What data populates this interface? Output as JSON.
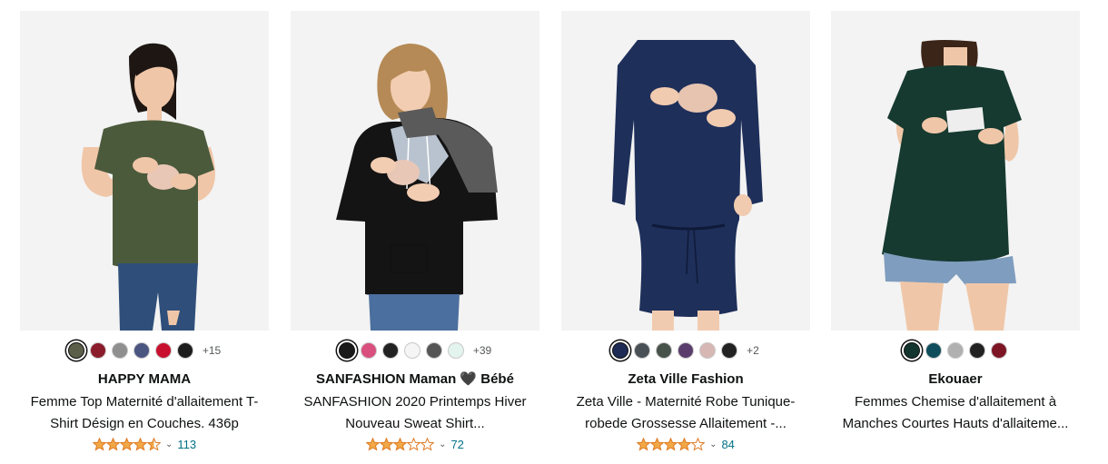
{
  "products": [
    {
      "brand": "HAPPY MAMA",
      "title": "Femme Top Maternité d'allaitement T-Shirt Désign en Couches. 436p",
      "rating": 4.5,
      "stars": [
        "full",
        "full",
        "full",
        "full",
        "half"
      ],
      "review_count": "113",
      "more_colors": "+15",
      "swatches": [
        "#5b5f4a",
        "#8a1c2b",
        "#8f8f8f",
        "#4a5580",
        "#c8102e",
        "#1c1c1c"
      ],
      "selected_swatch": 0,
      "image": {
        "bg": "#f3f3f3",
        "top": "#4c5a3c",
        "bottom": "#2f4f7a",
        "skin": "#f0c6a8",
        "hair": "#1d1612",
        "inner": "#e9c7b7"
      }
    },
    {
      "brand": "SANFASHION Maman 🖤 Bébé",
      "title": "SANFASHION 2020 Printemps Hiver Nouveau Sweat Shirt...",
      "rating": 3.0,
      "stars": [
        "full",
        "full",
        "full",
        "empty",
        "empty"
      ],
      "review_count": "72",
      "more_colors": "+39",
      "swatches": [
        "#1a1a1a",
        "#d94f7e",
        "#222222",
        "#f5f5f5",
        "#555555",
        "#e3f3ee"
      ],
      "selected_swatch": 0,
      "image": {
        "bg": "#f3f3f3",
        "top": "#141414",
        "bottom": "#4b6f9e",
        "skin": "#f3cdb2",
        "hair": "#b58a56",
        "inner": "#e9c7b7",
        "accent": "#b9c3cf",
        "accent2": "#5a5a5a"
      }
    },
    {
      "brand": "Zeta Ville Fashion",
      "title": "Zeta Ville - Maternité Robe Tunique-robede Grossesse Allaitement -...",
      "rating": 4.0,
      "stars": [
        "full",
        "full",
        "full",
        "full",
        "empty"
      ],
      "review_count": "84",
      "more_colors": "+2",
      "swatches": [
        "#1e2b55",
        "#4a5156",
        "#47524a",
        "#5a3d6d",
        "#d6b7b3",
        "#222222"
      ],
      "selected_swatch": 0,
      "image": {
        "bg": "#f3f3f3",
        "top": "#1e2f5a",
        "bottom": "#1e2f5a",
        "skin": "#f1cbb0",
        "hair": "#2a1d16",
        "inner": "#e6c4b0"
      }
    },
    {
      "brand": "Ekouaer",
      "title": "Femmes Chemise d'allaitement à Manches Courtes Hauts d'allaiteme...",
      "rating": 0,
      "stars": [],
      "review_count": "",
      "more_colors": "",
      "swatches": [
        "#14352e",
        "#0f4d5c",
        "#b0b0b0",
        "#222222",
        "#7d1524"
      ],
      "selected_swatch": 0,
      "image": {
        "bg": "#f3f3f3",
        "top": "#163a30",
        "bottom": "#7f9dbf",
        "skin": "#efc7a8",
        "hair": "#3b2418",
        "inner": "#eeeeee"
      }
    }
  ],
  "colors": {
    "star": "#f3a847",
    "star_border": "#de7921",
    "link": "#007185",
    "muted": "#565959"
  },
  "icons": {
    "star_full": "star-icon",
    "star_half": "star-half-icon",
    "star_empty": "star-empty-icon",
    "caret": "chevron-down-icon"
  }
}
